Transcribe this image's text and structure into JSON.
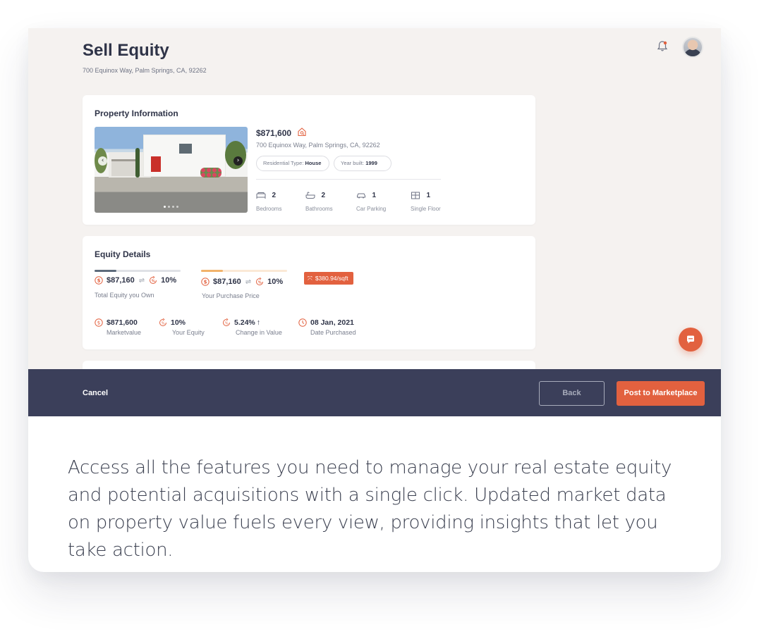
{
  "header": {
    "title": "Sell Equity",
    "address": "700 Equinox Way, Palm Springs, CA, 92262"
  },
  "property": {
    "section_title": "Property Information",
    "price": "$871,600",
    "address": "700 Equinox Way, Palm Springs, CA, 92262",
    "type_label": "Residential Type:",
    "type_value": "House",
    "year_label": "Year built:",
    "year_value": "1999",
    "features": [
      {
        "value": "2",
        "label": "Bedrooms",
        "icon": "bed-icon"
      },
      {
        "value": "2",
        "label": "Bathrooms",
        "icon": "bathtub-icon"
      },
      {
        "value": "1",
        "label": "Car Parking",
        "icon": "car-icon"
      },
      {
        "value": "1",
        "label": "Single Floor",
        "icon": "floor-plan-icon"
      }
    ],
    "carousel_slides": 4,
    "carousel_active": 1
  },
  "equity": {
    "section_title": "Equity Details",
    "owned": {
      "amount": "$87,160",
      "percent": "10%",
      "label": "Total Equity you Own",
      "bar_fraction": 0.25
    },
    "purchase": {
      "amount": "$87,160",
      "percent": "10%",
      "label": "Your Purchase Price",
      "bar_fraction": 0.25
    },
    "sqft_badge": "$380.94/sqft",
    "stats": [
      {
        "value": "$871,600",
        "label": "Marketvalue",
        "icon": "dollar-coin-icon"
      },
      {
        "value": "10%",
        "label": "Your Equity",
        "icon": "percent-cycle-icon"
      },
      {
        "value": "5.24%",
        "trend": "↑",
        "label": "Change in Value",
        "icon": "percent-cycle-icon"
      },
      {
        "value": "08 Jan, 2021",
        "label": "Date Purchased",
        "icon": "clock-icon"
      }
    ]
  },
  "footer": {
    "cancel": "Cancel",
    "back": "Back",
    "post": "Post to Marketplace"
  },
  "caption": "Access all the features you need to manage your real estate equity and potential acquisitions with a single click. Updated market data on property value fuels every view, providing insights that let you take action.",
  "colors": {
    "accent": "#e2613f",
    "navy": "#3b3f5a",
    "app_bg": "#f5f2f0"
  }
}
